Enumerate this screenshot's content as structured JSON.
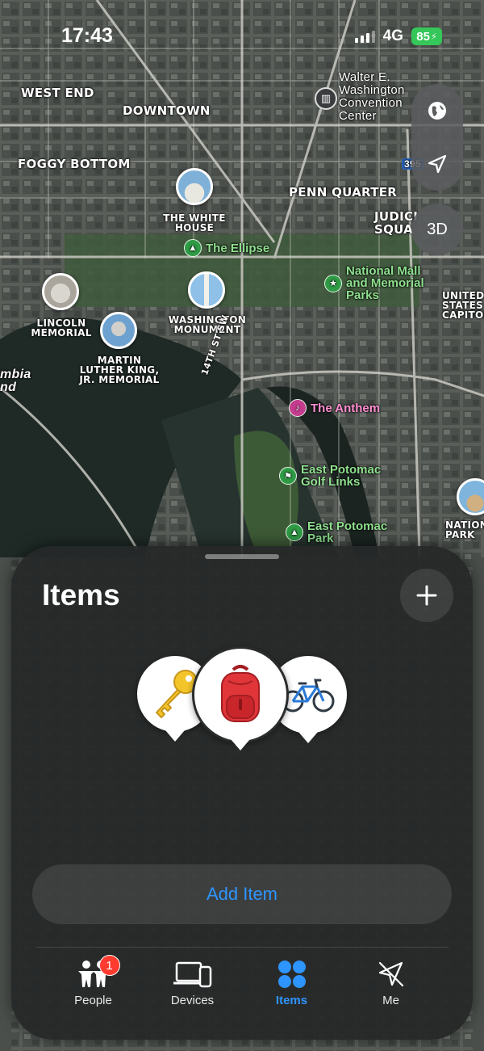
{
  "status_bar": {
    "time": "17:43",
    "network": "4G",
    "battery": "85"
  },
  "map": {
    "districts": {
      "west_end": "WEST END",
      "downtown": "DOWNTOWN",
      "foggy_bottom": "FOGGY BOTTOM",
      "penn_quarter": "PENN QUARTER",
      "judiciary": "JUDICI SQUA",
      "united_states_capitol": "UNITED STATES CAPITOL"
    },
    "pois": {
      "white_house": "THE WHITE HOUSE",
      "ellipse": "The Ellipse",
      "national_mall": "National Mall and Memorial Parks",
      "lincoln": "LINCOLN MEMORIAL",
      "washington_monument": "WASHINGTON MONUMENT",
      "mlk": "MARTIN LUTHER KING, JR. MEMORIAL",
      "anthem": "The Anthem",
      "golf": "East Potomac Golf Links",
      "east_potomac_park": "East Potomac Park",
      "convention_center": "Walter E. Washington Convention Center",
      "nationals_park": "NATION PARK"
    },
    "streets": {
      "fourteenth": "14TH ST SW"
    },
    "edge_labels": {
      "columbia": "mbia nd",
      "interstate": "395"
    }
  },
  "controls": {
    "three_d": "3D"
  },
  "sheet": {
    "title": "Items",
    "items": [
      {
        "name": "Keys",
        "icon": "key-icon"
      },
      {
        "name": "Backpack",
        "icon": "backpack-icon"
      },
      {
        "name": "Bike",
        "icon": "bicycle-icon"
      }
    ],
    "add_item_label": "Add Item"
  },
  "tabs": [
    {
      "label": "People",
      "icon": "people-icon",
      "badge": "1"
    },
    {
      "label": "Devices",
      "icon": "devices-icon"
    },
    {
      "label": "Items",
      "icon": "items-icon",
      "active": true
    },
    {
      "label": "Me",
      "icon": "me-icon"
    }
  ],
  "colors": {
    "accent": "#2e95ff",
    "poi_green": "#8fe08f",
    "badge": "#ff3b30",
    "battery": "#35c759"
  }
}
